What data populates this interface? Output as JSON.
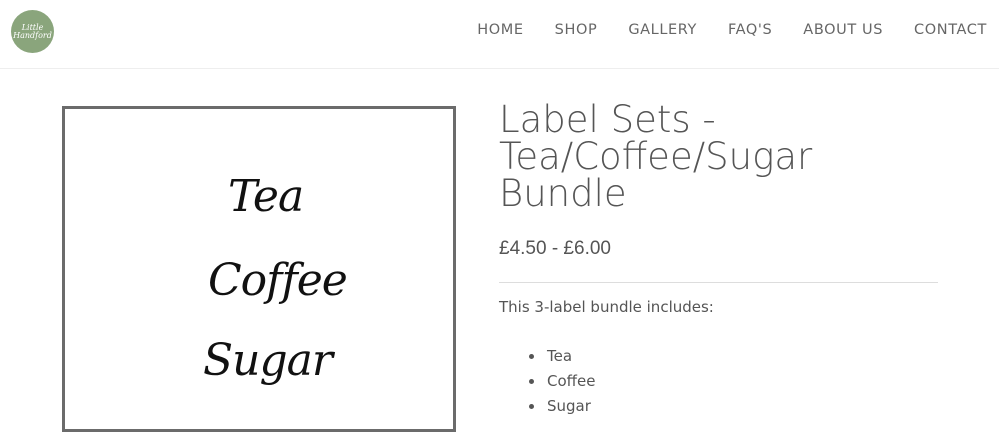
{
  "logo": {
    "text_line1": "Little",
    "text_line2": "Handford"
  },
  "nav": {
    "items": [
      "HOME",
      "SHOP",
      "GALLERY",
      "FAQ'S",
      "ABOUT US",
      "CONTACT"
    ]
  },
  "product": {
    "image_words": [
      "Tea",
      "Coffee",
      "Sugar"
    ],
    "title": "Label Sets - Tea/Coffee/Sugar Bundle",
    "price": "£4.50 - £6.00",
    "intro": "This 3-label bundle includes:",
    "features": [
      "Tea",
      "Coffee",
      "Sugar"
    ]
  },
  "colors": {
    "logo_bg": "#8aa57c",
    "text": "#555555",
    "border": "#6b6b6b"
  }
}
